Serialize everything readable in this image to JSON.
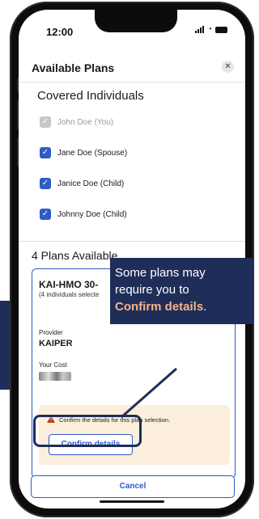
{
  "status": {
    "time": "12:00"
  },
  "header": {
    "title": "Available Plans",
    "close_icon": "close-icon"
  },
  "covered": {
    "title": "Covered Individuals",
    "people": [
      {
        "name": "John Doe (You)",
        "checked": true,
        "disabled": true
      },
      {
        "name": "Jane Doe (Spouse)",
        "checked": true,
        "disabled": false
      },
      {
        "name": "Janice Doe (Child)",
        "checked": true,
        "disabled": false
      },
      {
        "name": "Johnny Doe (Child)",
        "checked": true,
        "disabled": false
      }
    ]
  },
  "plans": {
    "title": "4 Plans Available",
    "card": {
      "name": "KAI-HMO 30-",
      "subtitle": "(4 individuals selecte",
      "provider_label": "Provider",
      "provider_value": "KAIPER",
      "cost_label": "Your Cost",
      "warning_text": "Confirm the details for this plan selection.",
      "confirm_label": "Confirm details"
    }
  },
  "footer": {
    "cancel_label": "Cancel"
  },
  "callout": {
    "line1": "Some plans may",
    "line2": "require you to",
    "line3_highlight": "Confirm details",
    "line3_end": "."
  },
  "colors": {
    "accent": "#2e5bc4",
    "navy": "#1f2e58",
    "warning_bg": "#fbefdc",
    "highlight_text": "#f4b38a"
  }
}
